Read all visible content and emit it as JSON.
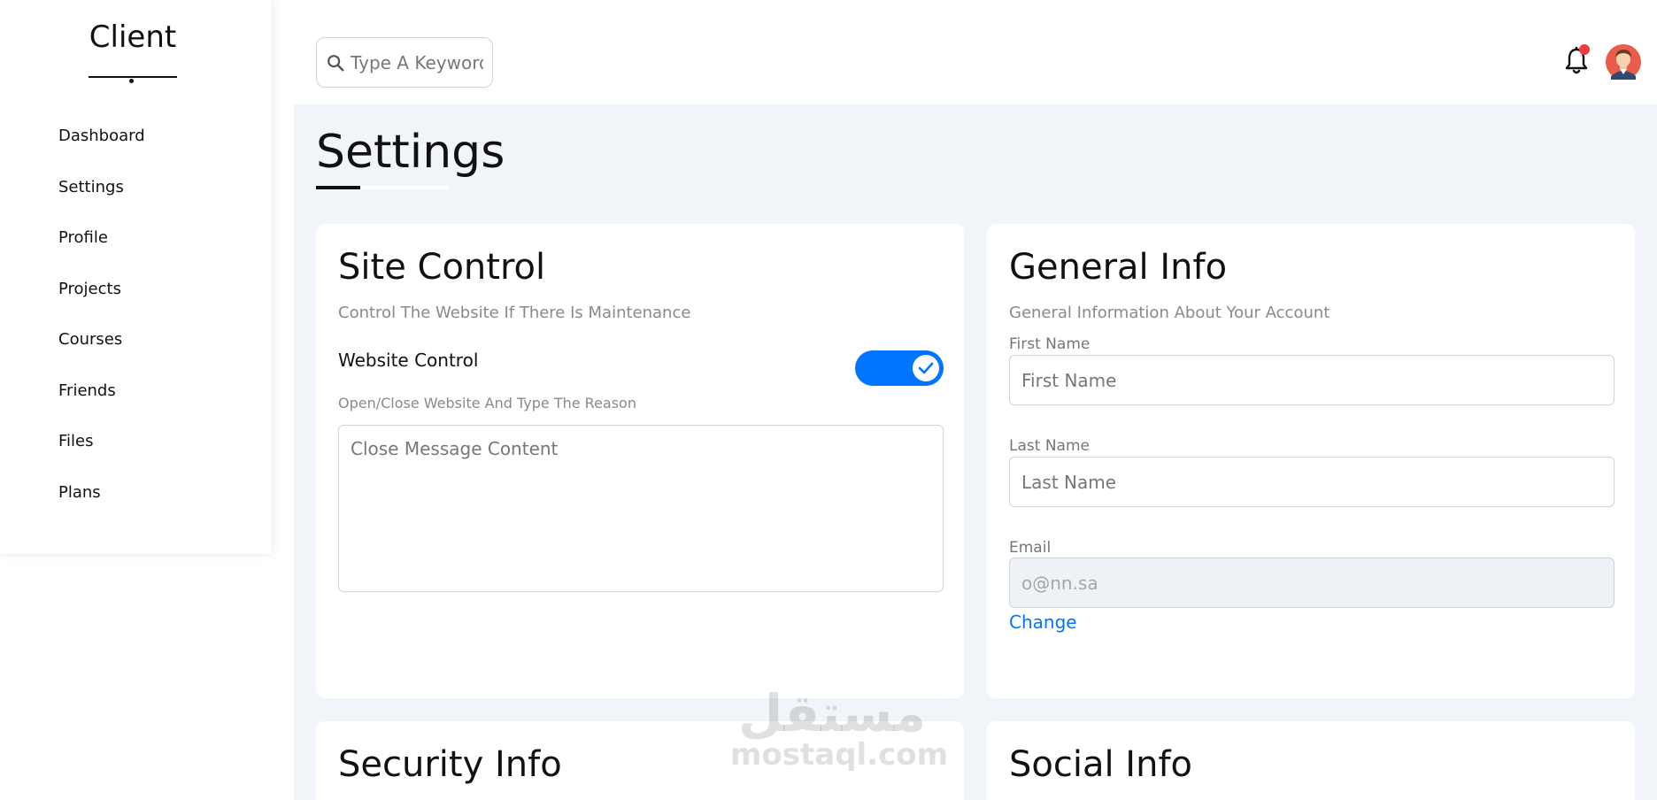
{
  "sidebar": {
    "brand": "Client",
    "items": [
      {
        "label": "Dashboard"
      },
      {
        "label": "Settings"
      },
      {
        "label": "Profile"
      },
      {
        "label": "Projects"
      },
      {
        "label": "Courses"
      },
      {
        "label": "Friends"
      },
      {
        "label": "Files"
      },
      {
        "label": "Plans"
      }
    ]
  },
  "header": {
    "search_placeholder": "Type A Keyword",
    "notification_dot_color": "#ef3b3b",
    "icons": [
      "search-icon",
      "bell-icon",
      "avatar"
    ]
  },
  "page": {
    "title": "Settings"
  },
  "site_control": {
    "title": "Site Control",
    "subtitle": "Control The Website If There Is Maintenance",
    "website_control_label": "Website Control",
    "toggle_on": true,
    "toggle_color": "#0075ff",
    "reason_label": "Open/Close Website And Type The Reason",
    "message_placeholder": "Close Message Content"
  },
  "general_info": {
    "title": "General Info",
    "subtitle": "General Information About Your Account",
    "first_name_label": "First Name",
    "first_name_placeholder": "First Name",
    "last_name_label": "Last Name",
    "last_name_placeholder": "Last Name",
    "email_label": "Email",
    "email_placeholder": "o@nn.sa",
    "change_link": "Change"
  },
  "security_info": {
    "title": "Security Info"
  },
  "social_info": {
    "title": "Social Info"
  },
  "watermark": {
    "arabic": "مستقل",
    "latin": "mostaql.com"
  }
}
